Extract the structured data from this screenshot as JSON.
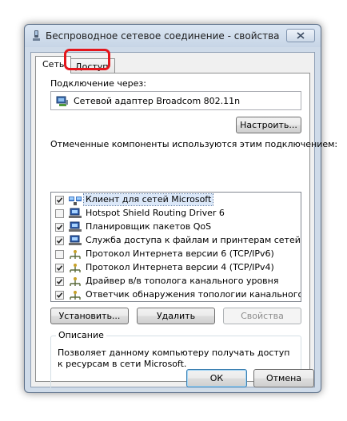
{
  "window": {
    "title": "Беспроводное сетевое соединение - свойства"
  },
  "tabs": [
    {
      "label": "Сеть",
      "active": true
    },
    {
      "label": "Доступ",
      "active": false,
      "highlighted": true
    }
  ],
  "connection": {
    "label": "Подключение через:",
    "adapter_name": "Сетевой адаптер Broadcom 802.11n",
    "configure_label": "Настроить..."
  },
  "components": {
    "label": "Отмеченные компоненты используются этим подключением:",
    "items": [
      {
        "label": "Клиент для сетей Microsoft",
        "checked": true,
        "icon": "network-client-icon",
        "selected": true
      },
      {
        "label": "Hotspot Shield Routing Driver 6",
        "checked": false,
        "icon": "network-service-icon"
      },
      {
        "label": "Планировщик пакетов QoS",
        "checked": true,
        "icon": "network-service-icon"
      },
      {
        "label": "Служба доступа к файлам и принтерам сетей Micro...",
        "checked": true,
        "icon": "network-service-icon"
      },
      {
        "label": "Протокол Интернета версии 6 (TCP/IPv6)",
        "checked": false,
        "icon": "protocol-icon"
      },
      {
        "label": "Протокол Интернета версии 4 (TCP/IPv4)",
        "checked": true,
        "icon": "protocol-icon"
      },
      {
        "label": "Драйвер в/в тополога канального уровня",
        "checked": true,
        "icon": "protocol-icon"
      },
      {
        "label": "Ответчик обнаружения топологии канального уровня",
        "checked": true,
        "icon": "protocol-icon"
      }
    ]
  },
  "actions": {
    "install_label": "Установить...",
    "remove_label": "Удалить",
    "properties_label": "Свойства"
  },
  "description": {
    "title": "Описание",
    "text": "Позволяет данному компьютеру получать доступ к ресурсам в сети Microsoft."
  },
  "footer": {
    "ok_label": "ОК",
    "cancel_label": "Отмена"
  },
  "colors": {
    "highlight_ring": "#e4161c",
    "selection": "#dbe8f9"
  }
}
